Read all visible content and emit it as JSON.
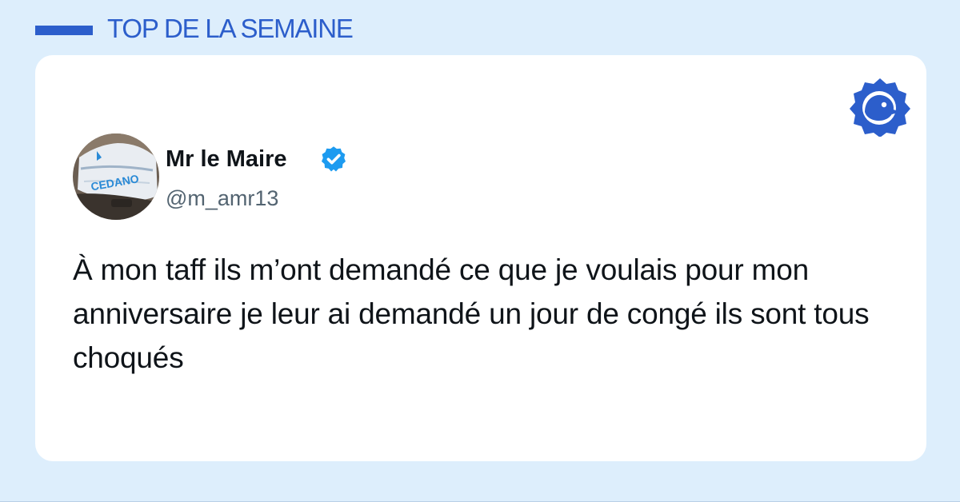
{
  "header": {
    "title": "TOP DE LA SEMAINE",
    "bar_color": "#2c5ecb"
  },
  "brand": {
    "icon": "bird-seal-logo-icon",
    "color": "#2c5ecb"
  },
  "tweet": {
    "author_name": "Mr le Maire",
    "verified": true,
    "verified_icon": "verified-check-icon",
    "verified_color": "#1d9bf0",
    "handle": "@m_amr13",
    "text": "À mon taff ils m’ont demandé ce que je voulais pour mon anniversaire je leur ai demandé un jour de congé ils sont tous choqués",
    "avatar_jersey_text": "CEDANO"
  },
  "colors": {
    "background": "#ddeefc",
    "card": "#ffffff",
    "text": "#0f1419",
    "handle": "#536471"
  }
}
